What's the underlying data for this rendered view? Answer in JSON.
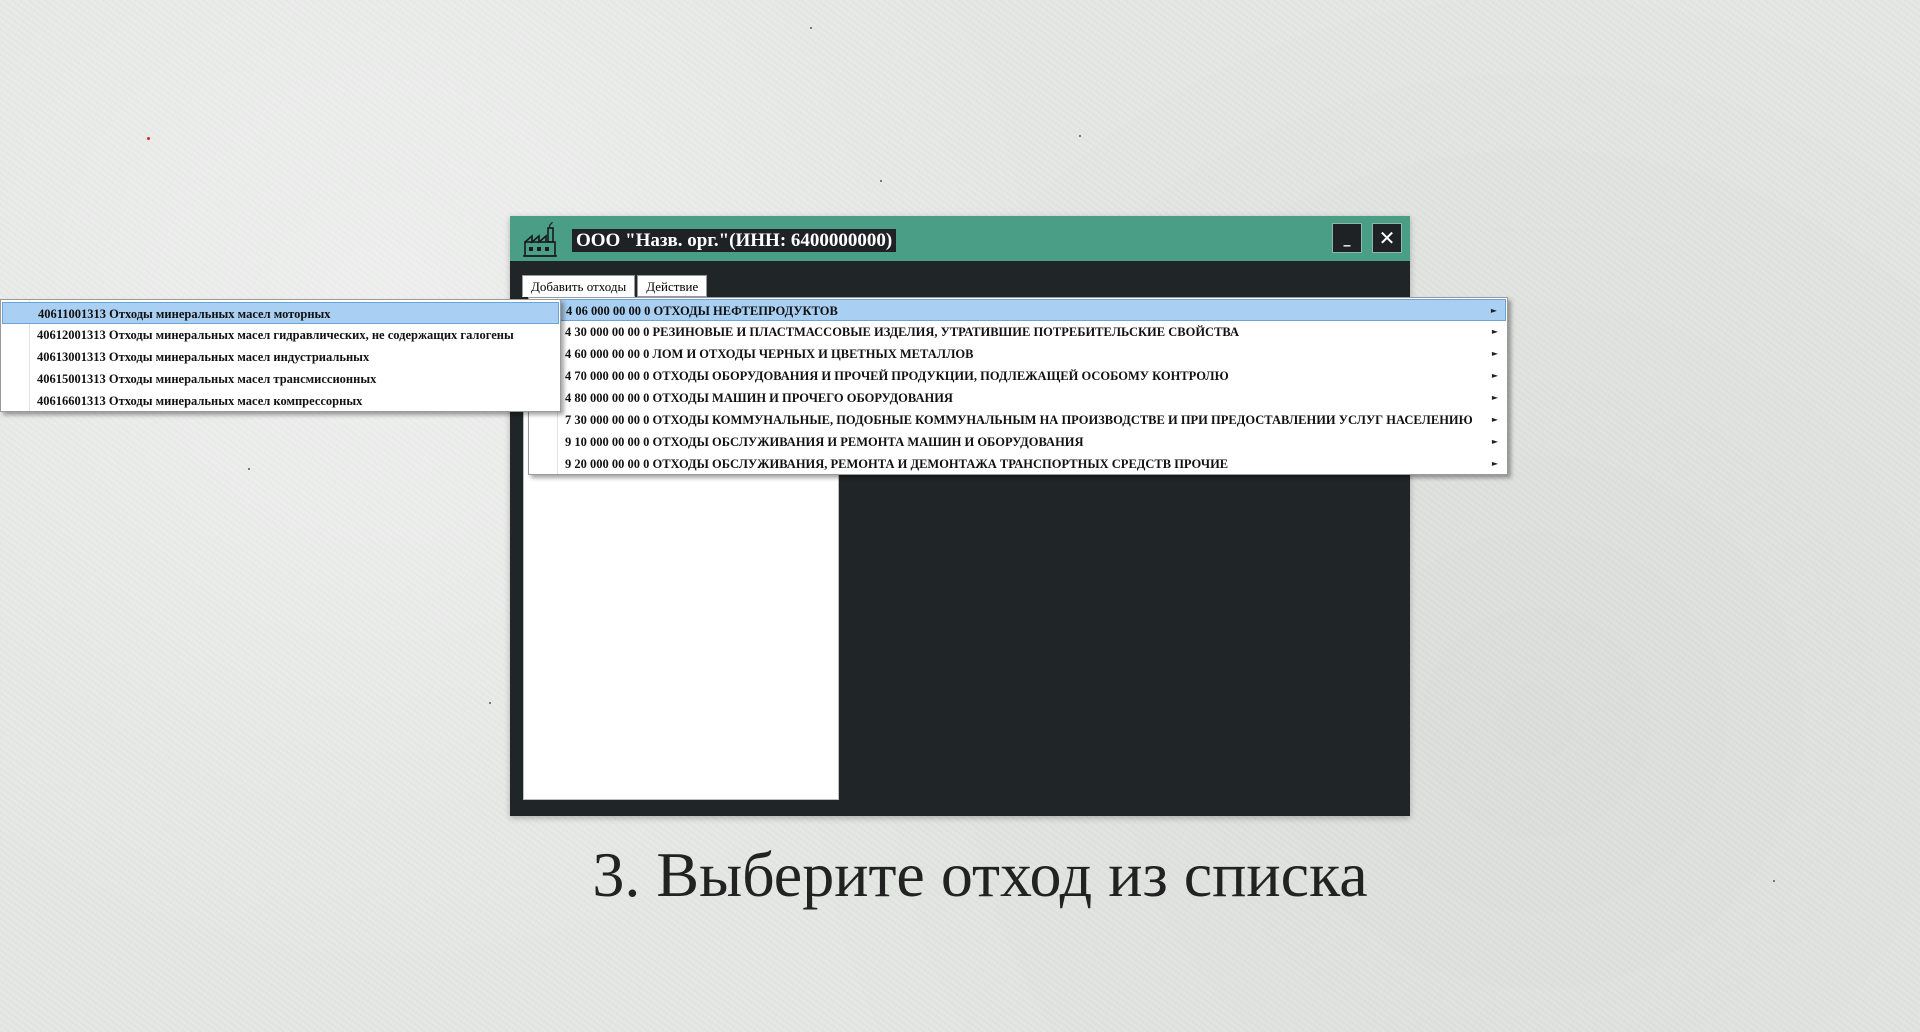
{
  "window": {
    "title": "ООО \"Назв. орг.\"(ИНН: 6400000000)",
    "minimize_label": "_",
    "close_label": "✕",
    "logo_icon": "factory-icon"
  },
  "tabs": [
    {
      "label": "Добавить отходы"
    },
    {
      "label": "Действие"
    }
  ],
  "menu": {
    "items": [
      {
        "label": "4 06 000 00 00 0 ОТХОДЫ НЕФТЕПРОДУКТОВ",
        "highlighted": true
      },
      {
        "label": "4 30 000 00 00 0 РЕЗИНОВЫЕ И ПЛАСТМАССОВЫЕ ИЗДЕЛИЯ, УТРАТИВШИЕ ПОТРЕБИТЕЛЬСКИЕ СВОЙСТВА"
      },
      {
        "label": "4 60 000 00 00 0 ЛОМ И ОТХОДЫ ЧЕРНЫХ И ЦВЕТНЫХ МЕТАЛЛОВ"
      },
      {
        "label": "4 70 000 00 00 0 ОТХОДЫ ОБОРУДОВАНИЯ И ПРОЧЕЙ ПРОДУКЦИИ, ПОДЛЕЖАЩЕЙ ОСОБОМУ КОНТРОЛЮ"
      },
      {
        "label": "4 80 000 00 00 0 ОТХОДЫ МАШИН И ПРОЧЕГО ОБОРУДОВАНИЯ"
      },
      {
        "label": "7 30 000 00 00 0 ОТХОДЫ КОММУНАЛЬНЫЕ, ПОДОБНЫЕ КОММУНАЛЬНЫМ НА ПРОИЗВОДСТВЕ И ПРИ ПРЕДОСТАВЛЕНИИ УСЛУГ НАСЕЛЕНИЮ"
      },
      {
        "label": "9 10 000 00 00 0 ОТХОДЫ ОБСЛУЖИВАНИЯ И РЕМОНТА МАШИН И ОБОРУДОВАНИЯ"
      },
      {
        "label": "9 20 000 00 00 0 ОТХОДЫ ОБСЛУЖИВАНИЯ, РЕМОНТА И ДЕМОНТАЖА ТРАНСПОРТНЫХ СРЕДСТВ ПРОЧИЕ"
      }
    ],
    "submenu_arrow": "►"
  },
  "submenu": {
    "items": [
      {
        "label": "40611001313 Отходы минеральных масел моторных",
        "highlighted": true
      },
      {
        "label": "40612001313 Отходы минеральных масел гидравлических, не содержащих галогены"
      },
      {
        "label": "40613001313 Отходы минеральных масел индустриальных"
      },
      {
        "label": "40615001313 Отходы минеральных масел трансмиссионных"
      },
      {
        "label": "40616601313 Отходы минеральных масел компрессорных"
      }
    ]
  },
  "caption": "3. Выберите отход из списка",
  "colors": {
    "titlebar": "#4a9e85",
    "window_body": "#202628",
    "highlight": "#a9cff2",
    "background": "#e6e8e6"
  }
}
